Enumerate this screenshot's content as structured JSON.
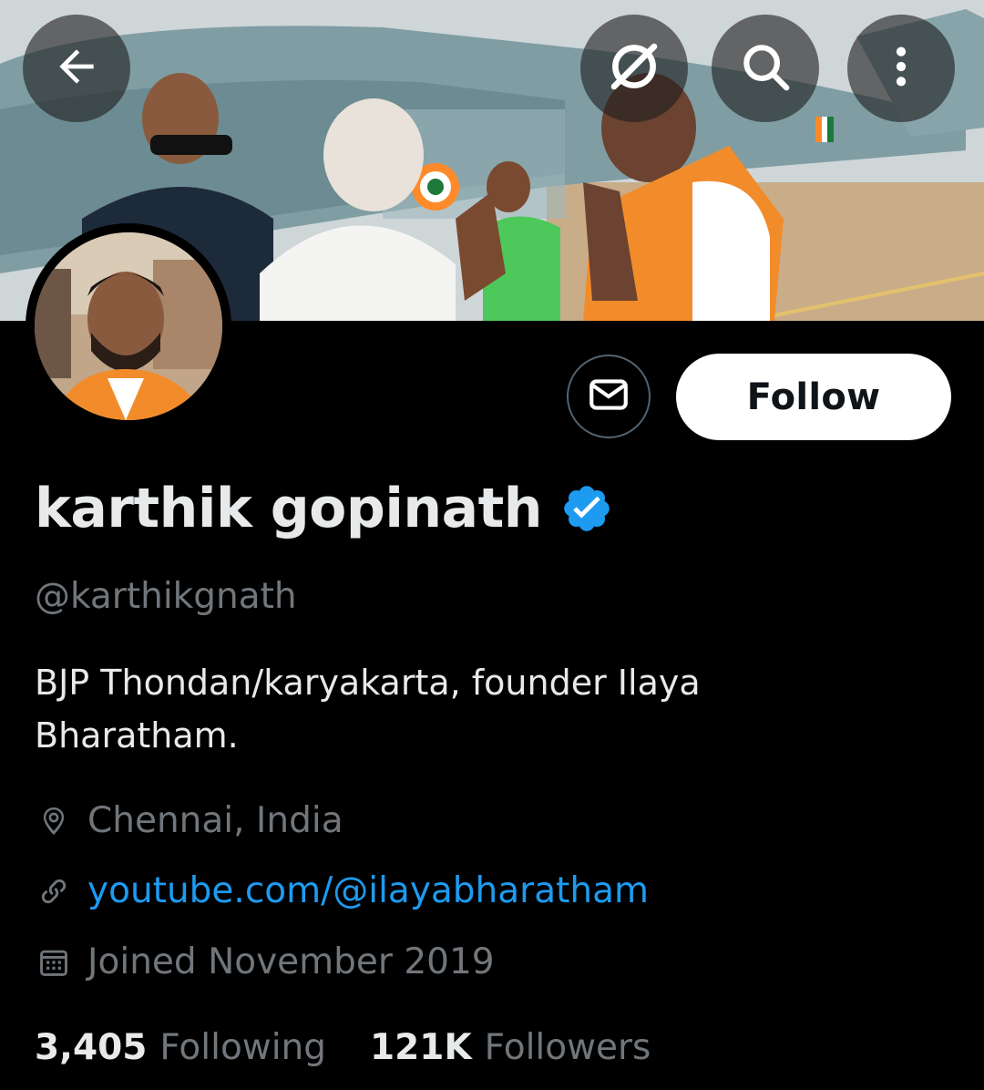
{
  "header": {
    "back_icon": "arrow-left-icon",
    "grok_icon": "grok-icon",
    "search_icon": "search-icon",
    "more_icon": "more-vertical-icon"
  },
  "profile": {
    "display_name": "karthik gopinath",
    "verified": true,
    "handle": "@karthikgnath",
    "bio": "BJP Thondan/karyakarta, founder Ilaya\nBharatham.",
    "location": "Chennai, India",
    "website": "youtube.com/@ilayabharatham",
    "joined": "Joined November 2019"
  },
  "actions": {
    "follow_label": "Follow",
    "message_icon": "envelope-icon"
  },
  "stats": {
    "following_count": "3,405",
    "following_label": "Following",
    "followers_count": "121K",
    "followers_label": "Followers"
  },
  "colors": {
    "background": "#000000",
    "primary_text": "#e7e9ea",
    "secondary_text": "#71767b",
    "link": "#1d9bf0",
    "verified_badge": "#1d9bf0",
    "follow_button_bg": "#ffffff"
  }
}
